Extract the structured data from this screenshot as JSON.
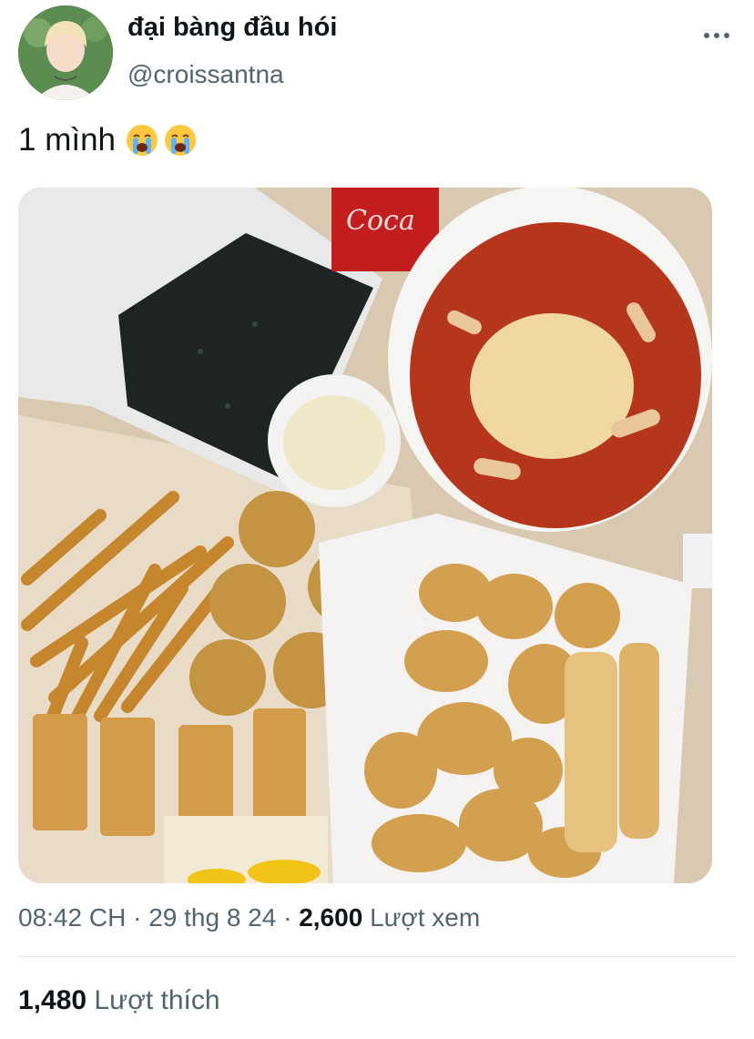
{
  "tweet": {
    "display_name": "đại bàng đầu hói",
    "handle": "@croissantna",
    "text": "1 mình",
    "emojis": [
      "😭",
      "😭"
    ],
    "time": "08:42 CH",
    "date": "29 thg 8 24",
    "separator": "·",
    "views_count": "2,600",
    "views_label": "Lượt xem",
    "likes_count": "1,480",
    "likes_label": "Lượt thích"
  },
  "icons": {
    "more": "more-horizontal-icon",
    "emoji": "loudly-crying-face-icon"
  },
  "colors": {
    "text": "#0f1419",
    "secondary": "#536471",
    "divider": "#e1e6ea"
  }
}
